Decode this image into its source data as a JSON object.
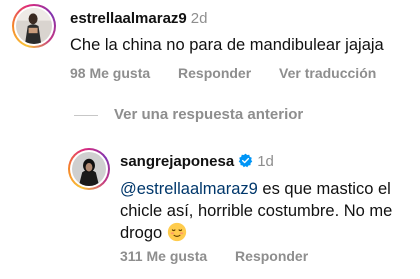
{
  "comment": {
    "username": "estrellaalmaraz9",
    "time": "2d",
    "text": "Che la china no para de mandibulear jajaja",
    "likes": "98 Me gusta",
    "reply": "Responder",
    "translate": "Ver traducción"
  },
  "view_previous": "Ver una respuesta anterior",
  "reply": {
    "username": "sangrejaponesa",
    "time": "1d",
    "mention": "@estrellaalmaraz9",
    "text_line1": " es que mastico el",
    "text_line2": "chicle así, horrible costumbre. No me",
    "text_line3": "drogo ",
    "likes": "311 Me gusta",
    "reply": "Responder"
  },
  "colors": {
    "mention": "#00376b",
    "verified": "#0095f6",
    "meta": "#8e8e8e"
  }
}
